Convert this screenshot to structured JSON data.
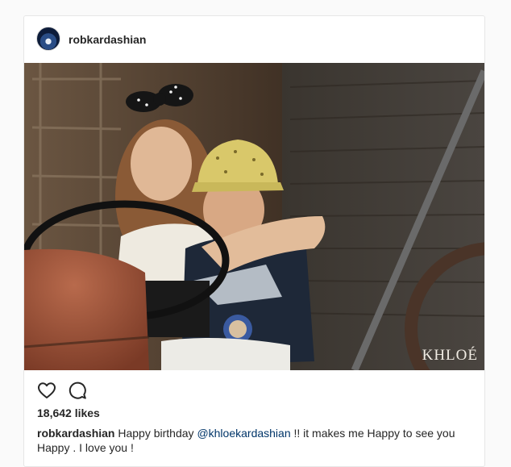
{
  "post": {
    "username": "robkardashian",
    "photo": {
      "watermark": "KHLOÉ"
    },
    "actions": {
      "like_icon": "heart-icon",
      "comment_icon": "comment-icon"
    },
    "likes": "18,642 likes",
    "caption": {
      "username": "robkardashian",
      "text_before": " Happy birthday ",
      "mention": "@khloekardashian",
      "text_after": " !! it makes me Happy to see you Happy . I love you !"
    }
  },
  "colors": {
    "page_background": "#fafafa",
    "card_background": "#ffffff",
    "border": "#e6e6e6",
    "text": "#262626",
    "mention": "#003569"
  }
}
